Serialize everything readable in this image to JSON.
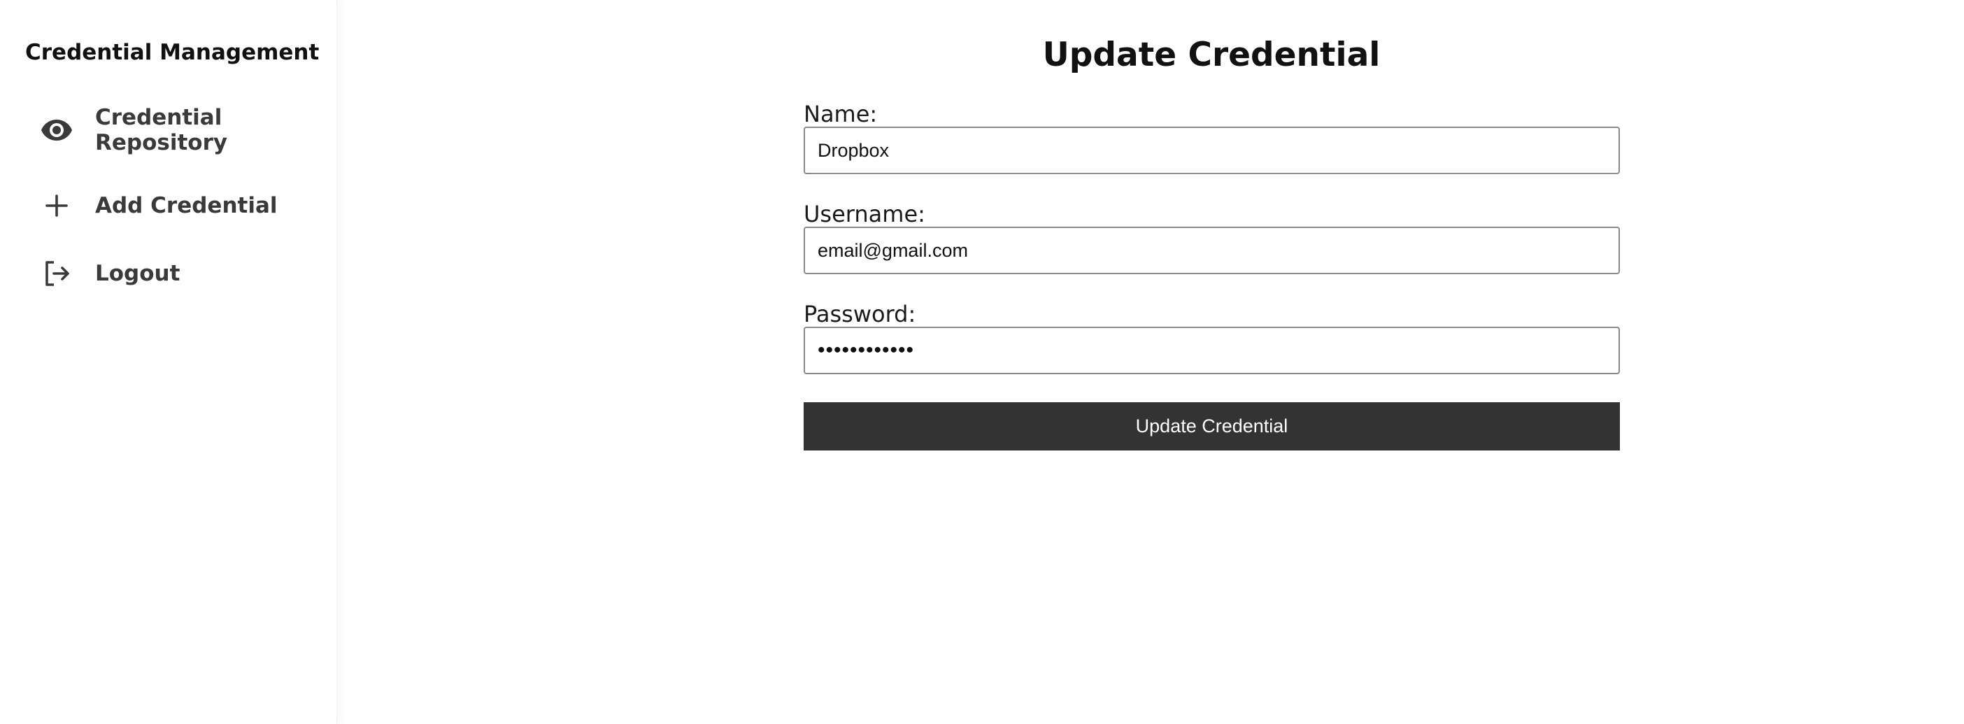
{
  "sidebar": {
    "title": "Credential Management",
    "items": [
      {
        "label": "Credential Repository",
        "icon": "eye-icon"
      },
      {
        "label": "Add Credential",
        "icon": "plus-icon"
      },
      {
        "label": "Logout",
        "icon": "logout-icon"
      }
    ]
  },
  "main": {
    "title": "Update Credential",
    "form": {
      "name_label": "Name:",
      "name_value": "Dropbox",
      "username_label": "Username:",
      "username_value": "email@gmail.com",
      "password_label": "Password:",
      "password_value": "••••••••••••",
      "submit_label": "Update Credential"
    }
  },
  "colors": {
    "button_bg": "#333333",
    "button_text": "#ffffff",
    "input_border": "#8a8a8a",
    "nav_text": "#3a3a3a"
  }
}
